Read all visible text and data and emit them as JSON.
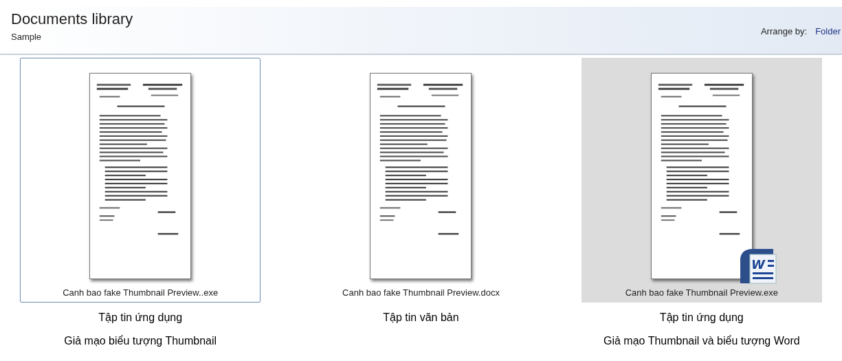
{
  "header": {
    "title": "Documents library",
    "subtitle": "Sample",
    "arrange_label": "Arrange by:",
    "arrange_value": "Folder"
  },
  "items": [
    {
      "filename": "Canh bao fake Thumbnail Preview..exe",
      "selected": true,
      "hovered": false,
      "notes": [
        "Tập tin ứng dụng",
        "Giả mạo biểu tượng Thumbnail"
      ]
    },
    {
      "filename": "Canh bao fake Thumbnail Preview.docx",
      "selected": false,
      "hovered": false,
      "notes": [
        "Tập tin văn bản"
      ]
    },
    {
      "filename": "Canh bao fake Thumbnail Preview.exe",
      "selected": false,
      "hovered": true,
      "badge_text": "W",
      "notes": [
        "Tập tin ứng dụng",
        "Giả mạo Thumbnail và biểu tượng Word"
      ]
    }
  ]
}
